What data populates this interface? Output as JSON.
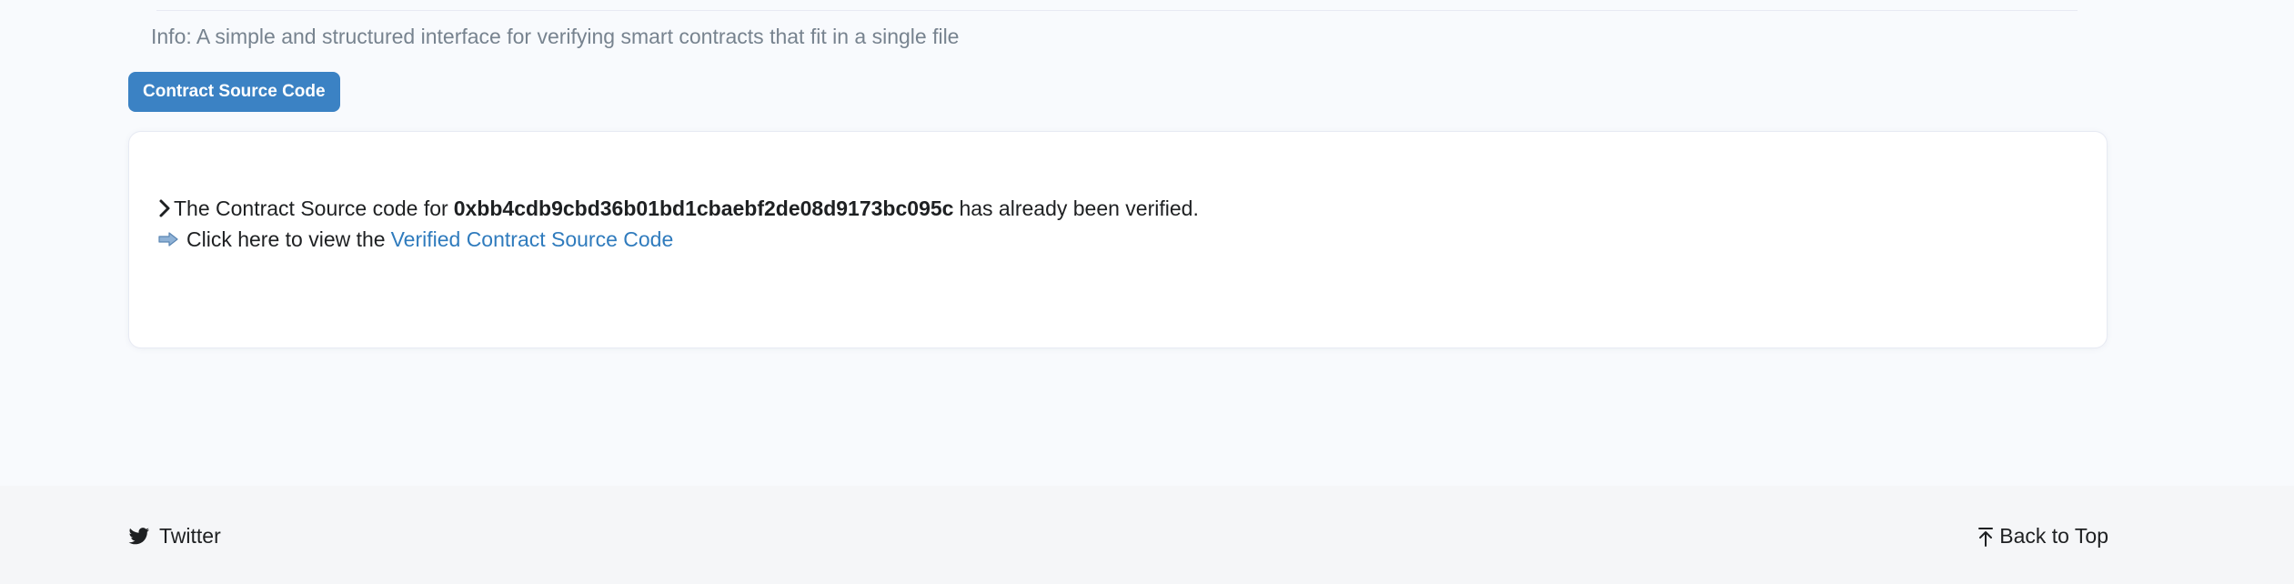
{
  "info": {
    "text": "Info: A simple and structured interface for verifying smart contracts that fit in a single file"
  },
  "tabs": {
    "active_label": "Contract Source Code"
  },
  "message": {
    "prefix": "The Contract Source code for",
    "address": "0xbb4cdb9cbd36b01bd1cbaebf2de08d9173bc095c",
    "suffix": "has already been verified.",
    "view_prefix": "Click here to view the",
    "view_link": "Verified Contract Source Code"
  },
  "footer": {
    "twitter_label": "Twitter",
    "back_to_top_label": "Back to Top"
  },
  "colors": {
    "accent": "#3b82c4",
    "link": "#2f7bbd",
    "muted_text": "#77838f",
    "footer_bg": "#f5f6f8"
  },
  "icons": {
    "chevron": "chevron-right-icon",
    "arrow": "arrow-right-icon",
    "twitter": "twitter-icon",
    "back_to_top": "arrow-up-to-line-icon"
  }
}
